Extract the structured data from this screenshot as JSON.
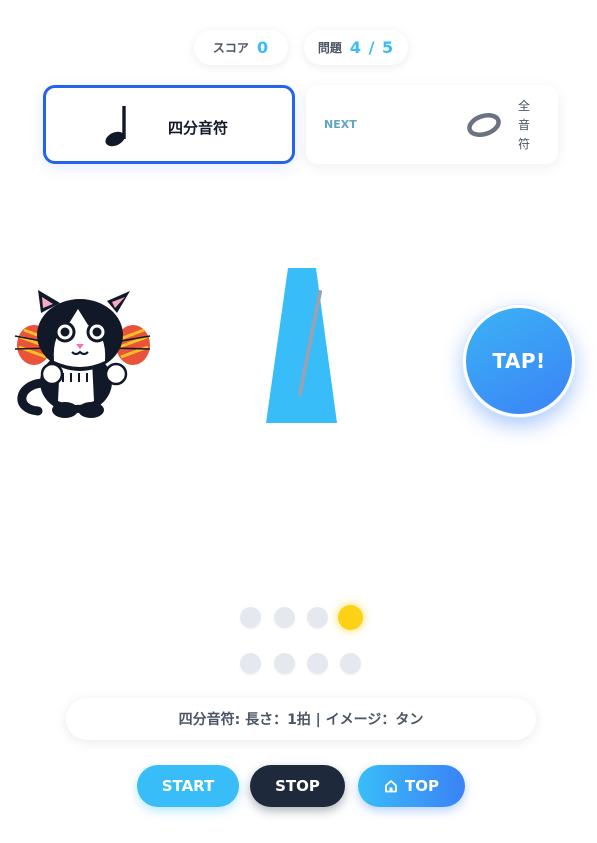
{
  "header": {
    "score_label": "スコア",
    "score_value": "0",
    "question_label": "問題",
    "question_value": "4 / 5"
  },
  "current_note": {
    "icon": "quarter-note-icon",
    "name": "四分音符"
  },
  "next_note": {
    "label": "NEXT",
    "icon": "whole-note-icon",
    "name_chars": [
      "全",
      "音",
      "符"
    ]
  },
  "tap_button": {
    "label": "TAP!"
  },
  "beats": {
    "row1_count": 4,
    "row1_active_index": 3,
    "row2_count": 4,
    "row2_active_index": -1
  },
  "info": {
    "text": "四分音符: 長さ：1拍 | イメージ：タン"
  },
  "controls": {
    "start_label": "START",
    "stop_label": "STOP",
    "top_label": "TOP",
    "top_icon": "home-icon"
  },
  "colors": {
    "accent": "#38bdf8",
    "primary": "#3b82f6",
    "border_active": "#2563eb",
    "beat_active": "#fcd116",
    "beat_idle": "#e5e9ef",
    "dark": "#1e293b"
  }
}
